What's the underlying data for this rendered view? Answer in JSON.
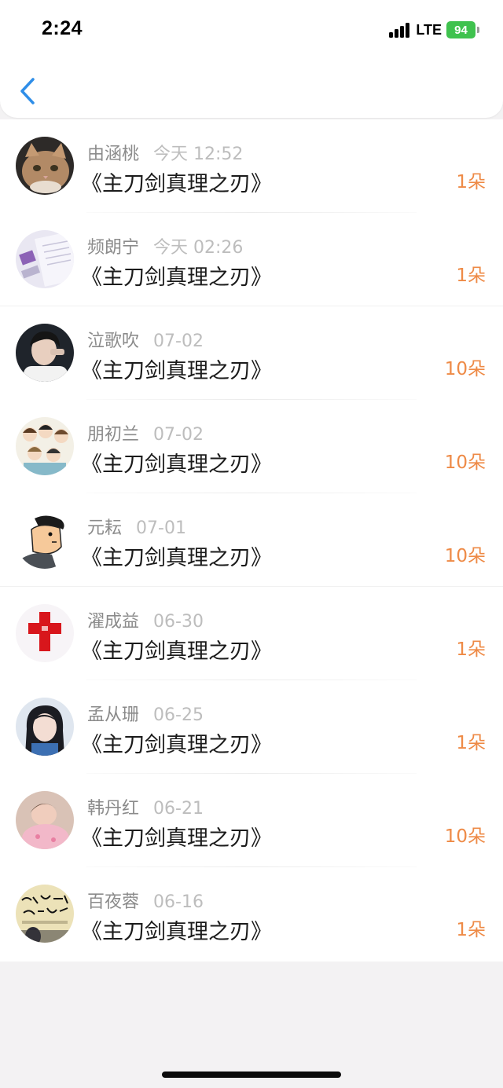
{
  "status_bar": {
    "time": "2:24",
    "network": "LTE",
    "battery": "94"
  },
  "header": {
    "back_icon": "chevron-left-icon"
  },
  "accent_color": "#ee8a46",
  "items": [
    {
      "name": "由涵桃",
      "date": "今天 12:52",
      "title": "《主刀剑真理之刃》",
      "count": "1朵"
    },
    {
      "name": "频朗宁",
      "date": "今天 02:26",
      "title": "《主刀剑真理之刃》",
      "count": "1朵"
    },
    {
      "name": "泣歌吹",
      "date": "07-02",
      "title": "《主刀剑真理之刃》",
      "count": "10朵"
    },
    {
      "name": "朋初兰",
      "date": "07-02",
      "title": "《主刀剑真理之刃》",
      "count": "10朵"
    },
    {
      "name": "元耘",
      "date": "07-01",
      "title": "《主刀剑真理之刃》",
      "count": "10朵"
    },
    {
      "name": "濯成益",
      "date": "06-30",
      "title": "《主刀剑真理之刃》",
      "count": "1朵"
    },
    {
      "name": "孟从珊",
      "date": "06-25",
      "title": "《主刀剑真理之刃》",
      "count": "1朵"
    },
    {
      "name": "韩丹红",
      "date": "06-21",
      "title": "《主刀剑真理之刃》",
      "count": "10朵"
    },
    {
      "name": "百夜蓉",
      "date": "06-16",
      "title": "《主刀剑真理之刃》",
      "count": "1朵"
    }
  ]
}
